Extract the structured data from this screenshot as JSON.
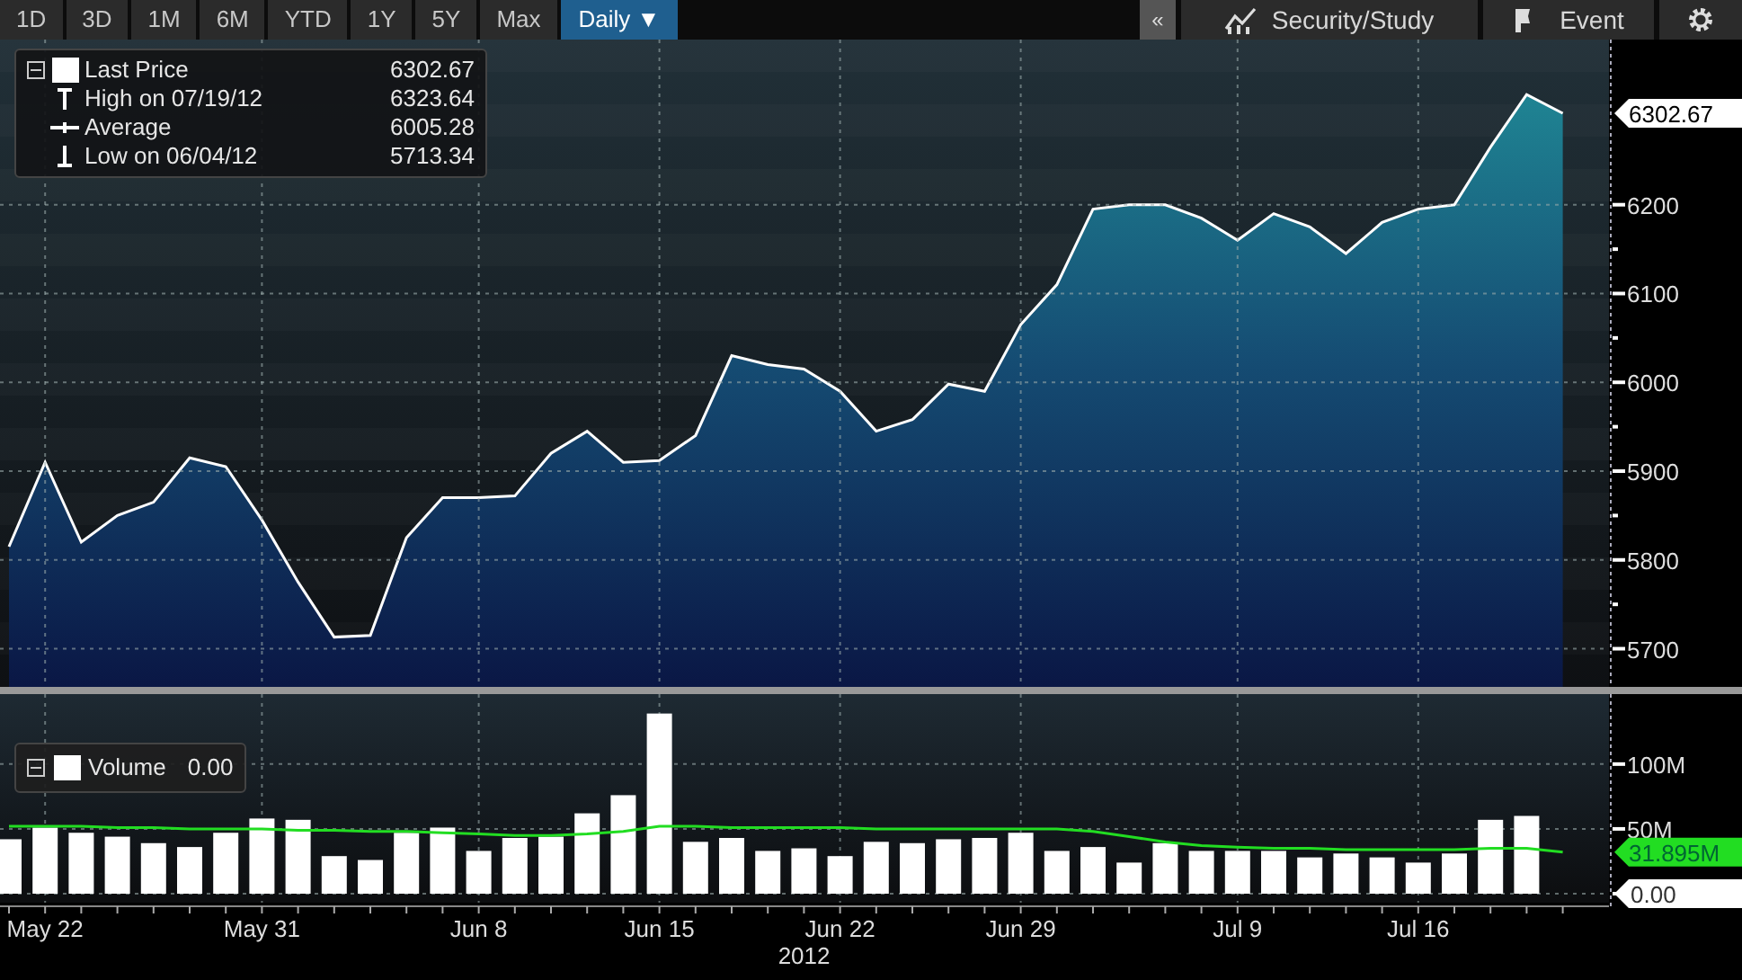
{
  "toolbar": {
    "range_buttons": [
      {
        "label": "1D",
        "selected": false
      },
      {
        "label": "3D",
        "selected": false
      },
      {
        "label": "1M",
        "selected": false
      },
      {
        "label": "6M",
        "selected": false
      },
      {
        "label": "YTD",
        "selected": false
      },
      {
        "label": "1Y",
        "selected": false
      },
      {
        "label": "5Y",
        "selected": false
      },
      {
        "label": "Max",
        "selected": false
      }
    ],
    "interval_dropdown": {
      "label": "Daily",
      "caret": "▼"
    },
    "collapse_button": "«",
    "security_button": "Security/Study",
    "event_button": "Event"
  },
  "price_chart": {
    "legend": [
      {
        "kind": "last",
        "value": "6302.67"
      },
      {
        "kind": "high",
        "label": "High on 07/19/12",
        "value": "6323.64"
      },
      {
        "kind": "average",
        "label": "Average",
        "value": "6005.28"
      },
      {
        "kind": "low",
        "label": "Low on 06/04/12",
        "value": "5713.34"
      }
    ],
    "last_tag": "6302.67",
    "chart_data": {
      "type": "area",
      "grid": true,
      "series": [
        {
          "name": "Last Price",
          "color": "#ffffff",
          "values": [
            5815,
            5910,
            5820,
            5850,
            5865,
            5915,
            5905,
            5845,
            5775,
            5713,
            5715,
            5825,
            5870,
            5870,
            5872,
            5920,
            5945,
            5910,
            5912,
            5940,
            6030,
            6020,
            6015,
            5990,
            5945,
            5958,
            5998,
            5990,
            6065,
            6110,
            6195,
            6200,
            6200,
            6185,
            6160,
            6190,
            6175,
            6145,
            6180,
            6195,
            6200,
            6265,
            6324,
            6303
          ]
        }
      ],
      "ylim": [
        5657,
        6386
      ],
      "yticks": [
        5700,
        5800,
        5900,
        6000,
        6100,
        6200
      ]
    }
  },
  "volume_chart": {
    "legend": {
      "value": "0.00"
    },
    "average_tag": "31.895M",
    "chart_data": {
      "type": "bar",
      "grid": true,
      "categories": [
        null,
        "May 22",
        null,
        null,
        null,
        null,
        null,
        "May 31",
        null,
        null,
        null,
        null,
        null,
        "Jun 8",
        null,
        null,
        null,
        null,
        "Jun 15",
        null,
        null,
        null,
        null,
        "Jun 22",
        null,
        null,
        null,
        null,
        "Jun 29",
        null,
        null,
        null,
        null,
        null,
        "Jul 9",
        null,
        null,
        null,
        null,
        "Jul 16",
        null,
        null,
        null,
        null
      ],
      "series": [
        {
          "name": "Volume",
          "color": "#ffffff",
          "values": [
            42,
            51,
            47,
            44,
            39,
            36,
            47,
            58,
            57,
            29,
            26,
            47,
            51,
            33,
            43,
            44,
            62,
            76,
            139,
            40,
            43,
            33,
            35,
            29,
            40,
            39,
            42,
            43,
            47,
            33,
            36,
            24,
            39,
            33,
            33,
            33,
            28,
            31,
            28,
            24,
            31,
            57,
            60,
            null
          ]
        },
        {
          "type": "line",
          "color": "#22dd22",
          "values": [
            52,
            52,
            52,
            51,
            51,
            50,
            50,
            50,
            49,
            49,
            48,
            48,
            47,
            46,
            45,
            45,
            46,
            48,
            52,
            52,
            51,
            51,
            51,
            51,
            50,
            50,
            50,
            50,
            50,
            50,
            48,
            44,
            40,
            37,
            36,
            35,
            35,
            34,
            34,
            34,
            34,
            35,
            35,
            32
          ]
        }
      ],
      "ylim": [
        0,
        154
      ],
      "yticks": [
        {
          "value": 0,
          "label": "0.00"
        },
        {
          "value": 50,
          "label": "50M"
        },
        {
          "value": 100,
          "label": "100M"
        }
      ],
      "xlabel": "2012"
    }
  }
}
